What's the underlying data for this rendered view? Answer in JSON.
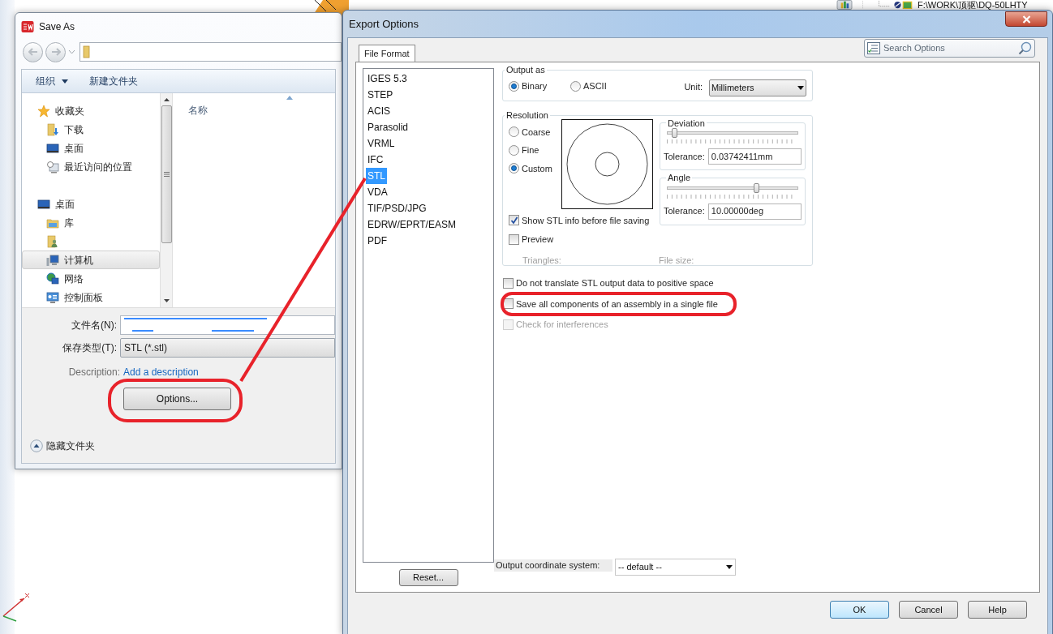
{
  "background": {
    "path_text": "F:\\WORK\\顶驱\\DQ-50LHTY"
  },
  "save_as": {
    "title": "Save As",
    "toolbar": [
      {
        "label": "组织",
        "kind": "menu"
      },
      {
        "label": "新建文件夹",
        "kind": "button"
      }
    ],
    "nav_tree": [
      {
        "label": "收藏夹",
        "kind": "star",
        "selected": false,
        "children": [
          {
            "label": "下载",
            "kind": "download",
            "selected": false
          },
          {
            "label": "桌面",
            "kind": "desktop",
            "selected": false
          },
          {
            "label": "最近访问的位置",
            "kind": "recent",
            "selected": false
          }
        ]
      },
      {
        "label": "桌面",
        "kind": "desktop",
        "selected": false,
        "children": [
          {
            "label": "库",
            "kind": "library",
            "selected": false
          },
          {
            "kind": "user",
            "selected": false
          },
          {
            "label": "计算机",
            "kind": "computer",
            "selected": true
          },
          {
            "label": "网络",
            "kind": "network",
            "selected": false
          },
          {
            "label": "控制面板",
            "kind": "control",
            "selected": false
          }
        ]
      }
    ],
    "column_header": "名称",
    "file_name": {
      "label": "文件名(N):"
    },
    "save_type": {
      "label": "保存类型(T):",
      "value": "STL (*.stl)"
    },
    "description": {
      "label": "Description:",
      "link": "Add a description"
    },
    "options_button": "Options...",
    "hide_folders": "隐藏文件夹"
  },
  "export_options": {
    "title": "Export Options",
    "tabs": [
      {
        "label": "File Format",
        "selected": true
      }
    ],
    "search": {
      "placeholder": "Search Options"
    },
    "formats": [
      {
        "label": "IGES 5.3",
        "selected": false
      },
      {
        "label": "STEP",
        "selected": false
      },
      {
        "label": "ACIS",
        "selected": false
      },
      {
        "label": "Parasolid",
        "selected": false
      },
      {
        "label": "VRML",
        "selected": false
      },
      {
        "label": "IFC",
        "selected": false
      },
      {
        "label": "STL",
        "selected": true
      },
      {
        "label": "VDA",
        "selected": false
      },
      {
        "label": "TIF/PSD/JPG",
        "selected": false
      },
      {
        "label": "EDRW/EPRT/EASM",
        "selected": false
      },
      {
        "label": "PDF",
        "selected": false
      }
    ],
    "reset_button": "Reset...",
    "output_as": {
      "title": "Output as",
      "options": [
        {
          "label": "Binary",
          "selected": true
        },
        {
          "label": "ASCII",
          "selected": false
        }
      ],
      "unit_label": "Unit:",
      "unit_value": "Millimeters"
    },
    "resolution": {
      "title": "Resolution",
      "options": [
        {
          "label": "Coarse",
          "selected": false
        },
        {
          "label": "Fine",
          "selected": false
        },
        {
          "label": "Custom",
          "selected": true
        }
      ],
      "deviation": {
        "title": "Deviation",
        "level": 0.05,
        "tolerance_label": "Tolerance:",
        "tolerance_value": "0.03742411mm"
      },
      "angle": {
        "title": "Angle",
        "level": 0.68,
        "tolerance_label": "Tolerance:",
        "tolerance_value": "10.00000deg"
      },
      "checks": [
        {
          "label": "Show STL info before file saving",
          "checked": true
        },
        {
          "label": "Preview",
          "checked": false
        }
      ],
      "triangles_label": "Triangles:",
      "file_size_label": "File size:"
    },
    "options": [
      {
        "label": "Do not translate STL output data to positive space",
        "checked": false,
        "disabled": false
      },
      {
        "label": "Save all components of an assembly in a single file",
        "checked": false,
        "disabled": false
      },
      {
        "label": "Check for interferences",
        "checked": false,
        "disabled": true
      }
    ],
    "coordinate_system": {
      "label": "Output coordinate system:",
      "value": "-- default --"
    },
    "buttons": [
      {
        "label": "OK",
        "default": true
      },
      {
        "label": "Cancel",
        "default": false
      },
      {
        "label": "Help",
        "default": false
      }
    ]
  }
}
